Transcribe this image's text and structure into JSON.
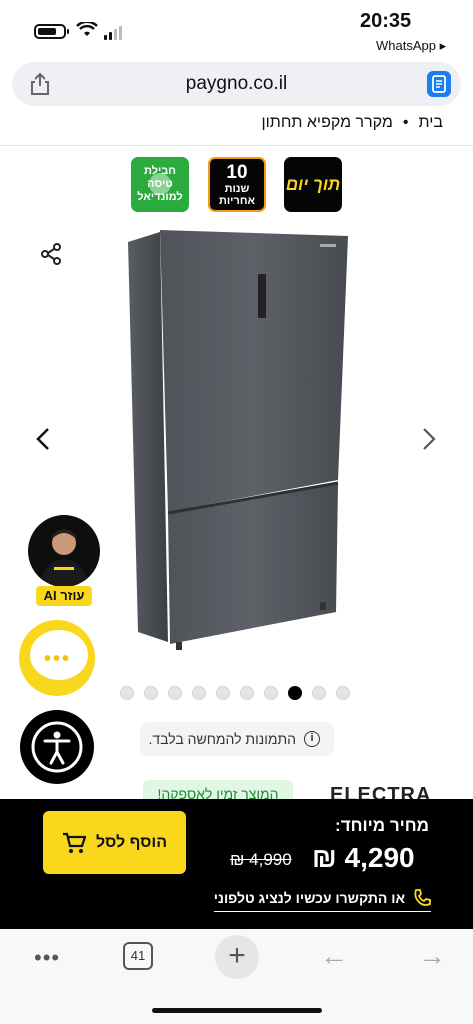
{
  "status": {
    "time": "20:35",
    "back_app": "WhatsApp"
  },
  "browser": {
    "url": "paygno.co.il",
    "tab_count": "41"
  },
  "breadcrumb": {
    "home": "בית",
    "separator": "•",
    "category": "מקרר מקפיא תחתון"
  },
  "badges": {
    "same_day": "תוך יום",
    "warranty_num": "10",
    "warranty_line1": "שנות",
    "warranty_line2": "אחריות",
    "world_line1": "חבילת טיסה",
    "world_line2": "למונדיאל"
  },
  "gallery": {
    "total_images": 10,
    "active_index": 7
  },
  "ai_helper": {
    "label": "עוזר AI"
  },
  "chat": {
    "dots": "•••"
  },
  "image_note": "התמונות להמחשה בלבד.",
  "availability": "המוצר זמין לאספקה!",
  "brand_name": "ELECTRA",
  "purchase": {
    "price_label": "מחיר מיוחד:",
    "old_price": "₪ 4,990",
    "new_price": "₪ 4,290",
    "add_to_cart": "הוסף לסל",
    "call_text": "או התקשרו עכשיו לנציג טלפוני"
  },
  "colors": {
    "accent_yellow": "#f9d71c",
    "bar_black": "#000000",
    "available_green": "#1f8a3a"
  },
  "icons": [
    "share-icon",
    "reader-icon",
    "chevron-left-icon",
    "chevron-right-icon",
    "chat-icon",
    "accessibility-icon",
    "cart-icon",
    "phone-icon",
    "info-icon",
    "more-icon",
    "plus-icon",
    "back-arrow-icon",
    "forward-arrow-icon"
  ]
}
